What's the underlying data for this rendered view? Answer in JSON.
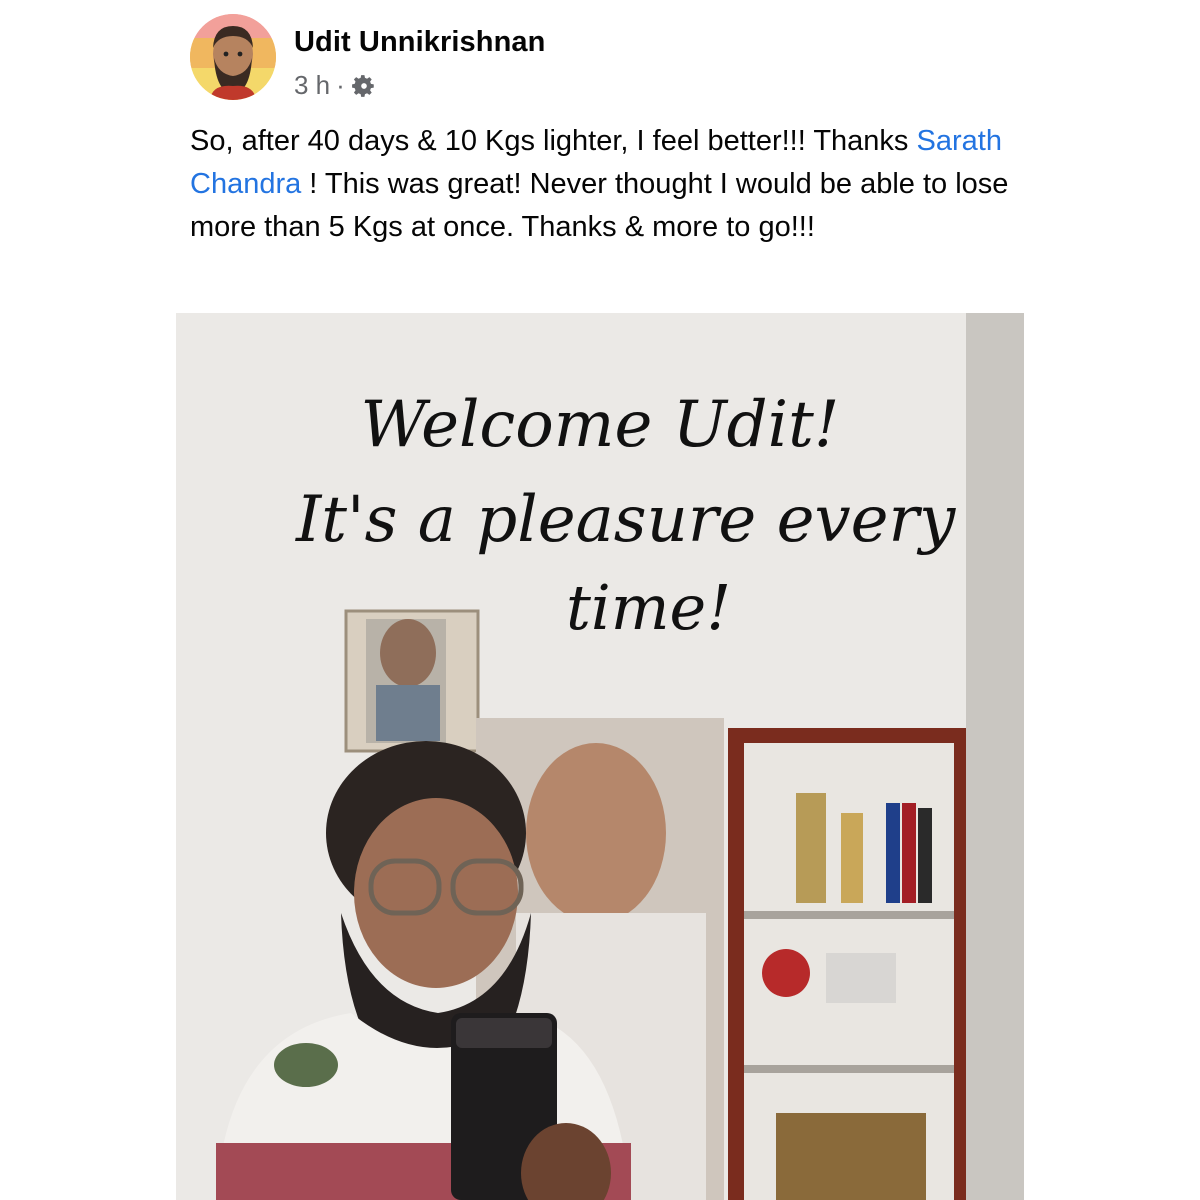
{
  "post": {
    "author": "Udit Unnikrishnan",
    "time": "3 h",
    "separator": "·",
    "privacy_icon": "gear-icon",
    "text_before_mention": "So, after 40 days & 10 Kgs lighter, I feel better!!! Thanks ",
    "mention": "Sarath Chandra",
    "text_after_mention": " ! This was great! Never thought I would be able to lose more than 5 Kgs at once. Thanks & more to go!!!"
  },
  "photo": {
    "overlay_line_1": "Welcome Udit!",
    "overlay_line_2": "It's a pleasure every",
    "overlay_line_3": "time!"
  },
  "colors": {
    "mention": "#2374e1",
    "meta": "#65676b",
    "text": "#050505"
  }
}
